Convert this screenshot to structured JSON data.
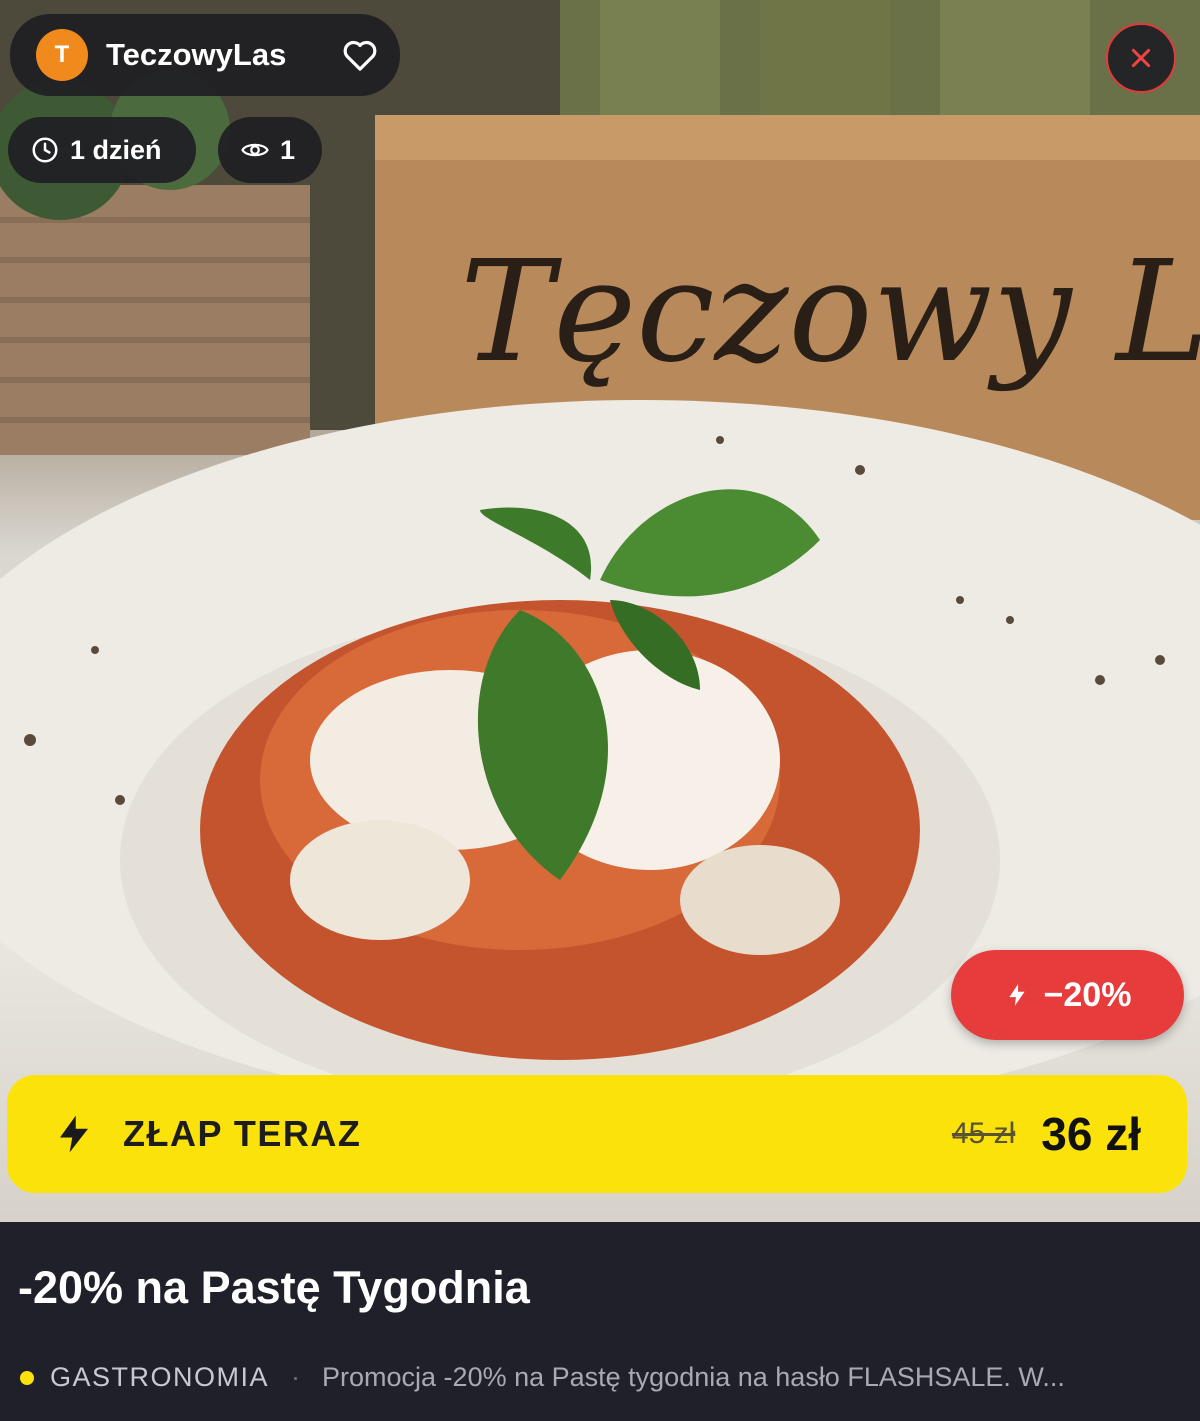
{
  "merchant": {
    "avatar_letter": "T",
    "name": "TeczowyLas"
  },
  "meta": {
    "time_left": "1 dzień",
    "views": "1"
  },
  "hero": {
    "sign_text": "Tęczowy La"
  },
  "badge": {
    "discount": "−20%"
  },
  "cta": {
    "label": "ZŁAP TERAZ",
    "old_price": "45 zł",
    "new_price": "36 zł"
  },
  "offer": {
    "title": "-20% na Pastę Tygodnia",
    "category": "GASTRONOMIA",
    "separator": "·",
    "description": "Promocja -20% na Pastę tygodnia na hasło FLASHSALE. W..."
  },
  "colors": {
    "accent_yellow": "#fbe20a",
    "discount_red": "#e73c3c",
    "avatar_orange": "#f08a1c",
    "dark_bg": "#1f2029"
  },
  "icons": [
    "heart-icon",
    "clock-icon",
    "eye-icon",
    "close-icon",
    "lightning-icon"
  ]
}
